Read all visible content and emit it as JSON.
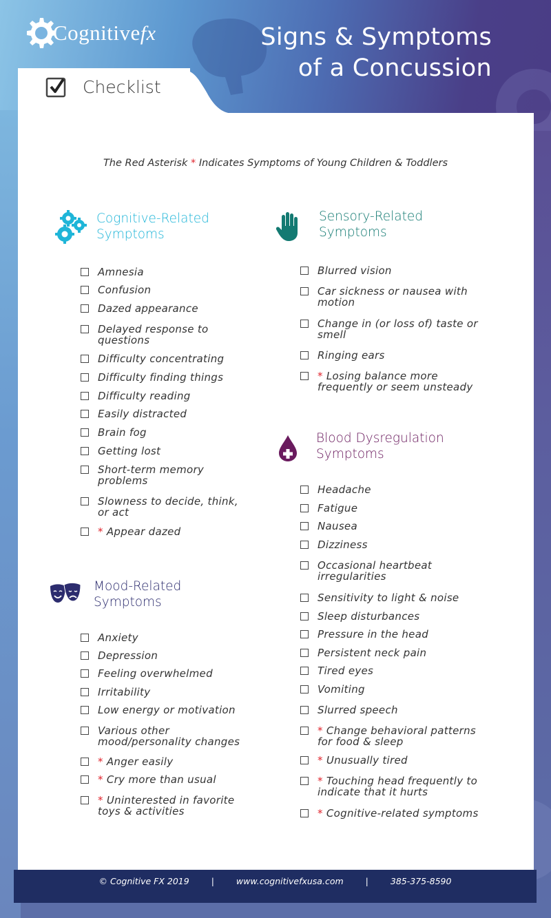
{
  "header": {
    "logo_main": "Cognitive",
    "logo_suffix": "fx",
    "title_line1": "Signs & Symptoms",
    "title_line2": "of a Concussion",
    "checklist_label": "Checklist"
  },
  "legend": {
    "prefix": "The Red Asterisk",
    "asterisk": "*",
    "suffix": "Indicates Symptoms of Young Children & Toddlers"
  },
  "colors": {
    "asterisk": "#e0242c",
    "cognitive": "#1fb5d8",
    "sensory": "#137a72",
    "blood": "#6a1b5e",
    "mood": "#2c2c6e",
    "footer_bg": "#1f2d62"
  },
  "sections": {
    "cognitive": {
      "icon": "gears-icon",
      "title_line1": "Cognitive-Related",
      "title_line2": "Symptoms",
      "items": [
        {
          "text": "Amnesia",
          "child": false
        },
        {
          "text": "Confusion",
          "child": false
        },
        {
          "text": "Dazed appearance",
          "child": false
        },
        {
          "text": "Delayed response to questions",
          "child": false
        },
        {
          "text": "Difficulty concentrating",
          "child": false
        },
        {
          "text": "Difficulty finding things",
          "child": false
        },
        {
          "text": "Difficulty reading",
          "child": false
        },
        {
          "text": "Easily distracted",
          "child": false
        },
        {
          "text": "Brain fog",
          "child": false
        },
        {
          "text": "Getting lost",
          "child": false
        },
        {
          "text": "Short-term memory problems",
          "child": false
        },
        {
          "text": "Slowness to decide, think, or act",
          "child": false
        },
        {
          "text": "Appear dazed",
          "child": true
        }
      ]
    },
    "mood": {
      "icon": "theater-masks-icon",
      "title_line1": "Mood-Related",
      "title_line2": "Symptoms",
      "items": [
        {
          "text": "Anxiety",
          "child": false
        },
        {
          "text": "Depression",
          "child": false
        },
        {
          "text": "Feeling overwhelmed",
          "child": false
        },
        {
          "text": "Irritability",
          "child": false
        },
        {
          "text": "Low energy or motivation",
          "child": false
        },
        {
          "text": "Various other mood/personality changes",
          "child": false
        },
        {
          "text": "Anger easily",
          "child": true
        },
        {
          "text": "Cry more than usual",
          "child": true
        },
        {
          "text": "Uninterested in favorite toys & activities",
          "child": true
        }
      ]
    },
    "sensory": {
      "icon": "hand-icon",
      "title_line1": "Sensory-Related",
      "title_line2": "Symptoms",
      "items": [
        {
          "text": "Blurred vision",
          "child": false
        },
        {
          "text": "Car sickness or nausea with motion",
          "child": false
        },
        {
          "text": "Change in (or loss of) taste or smell",
          "child": false
        },
        {
          "text": "Ringing ears",
          "child": false
        },
        {
          "text": "Losing balance more frequently or seem unsteady",
          "child": true
        }
      ]
    },
    "blood": {
      "icon": "blood-drop-plus-icon",
      "title_line1": "Blood Dysregulation",
      "title_line2": "Symptoms",
      "items": [
        {
          "text": "Headache",
          "child": false
        },
        {
          "text": "Fatigue",
          "child": false
        },
        {
          "text": "Nausea",
          "child": false
        },
        {
          "text": "Dizziness",
          "child": false
        },
        {
          "text": "Occasional heartbeat irregularities",
          "child": false
        },
        {
          "text": "Sensitivity to light & noise",
          "child": false
        },
        {
          "text": "Sleep disturbances",
          "child": false
        },
        {
          "text": "Pressure in the head",
          "child": false
        },
        {
          "text": "Persistent neck pain",
          "child": false
        },
        {
          "text": "Tired eyes",
          "child": false
        },
        {
          "text": "Vomiting",
          "child": false
        },
        {
          "text": "Slurred speech",
          "child": false
        },
        {
          "text": "Change behavioral patterns for food & sleep",
          "child": true
        },
        {
          "text": "Unusually tired",
          "child": true
        },
        {
          "text": "Touching head frequently to indicate that it hurts",
          "child": true
        },
        {
          "text": "Cognitive-related symptoms",
          "child": true
        }
      ]
    }
  },
  "footer": {
    "copyright": "© Cognitive FX 2019",
    "separator": "|",
    "website": "www.cognitivefxusa.com",
    "phone": "385-375-8590"
  }
}
